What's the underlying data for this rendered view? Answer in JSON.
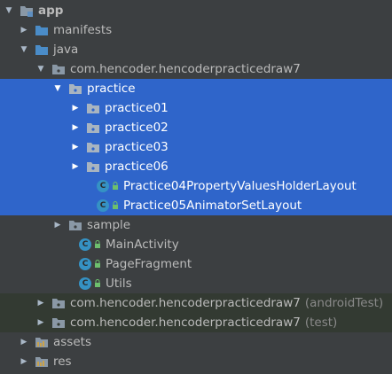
{
  "tree": {
    "app": "app",
    "manifests": "manifests",
    "java": "java",
    "pkg_main": "com.hencoder.hencoderpracticedraw7",
    "practice": "practice",
    "practice01": "practice01",
    "practice02": "practice02",
    "practice03": "practice03",
    "practice06": "practice06",
    "practice04_layout": "Practice04PropertyValuesHolderLayout",
    "practice05_layout": "Practice05AnimatorSetLayout",
    "sample": "sample",
    "main_activity": "MainActivity",
    "page_fragment": "PageFragment",
    "utils": "Utils",
    "pkg_android_test": "com.hencoder.hencoderpracticedraw7",
    "android_test_suffix": "(androidTest)",
    "pkg_test": "com.hencoder.hencoderpracticedraw7",
    "test_suffix": "(test)",
    "assets": "assets",
    "res": "res"
  },
  "class_badge": "C",
  "colors": {
    "background": "#3c3f41",
    "selection": "#2f65ca",
    "class_icon": "#3592c4",
    "folder": "#8a98a6",
    "source_folder": "#4a8cc8",
    "text": "#bbbbbb",
    "suffix_text": "#8a8a8a"
  },
  "icons": {
    "expanded": "triangle-down",
    "collapsed": "triangle-right",
    "module": "module-folder-icon",
    "folder": "folder-icon",
    "source_folder": "source-folder-icon",
    "package": "package-icon",
    "class": "class-icon",
    "resources": "resources-folder-icon"
  }
}
